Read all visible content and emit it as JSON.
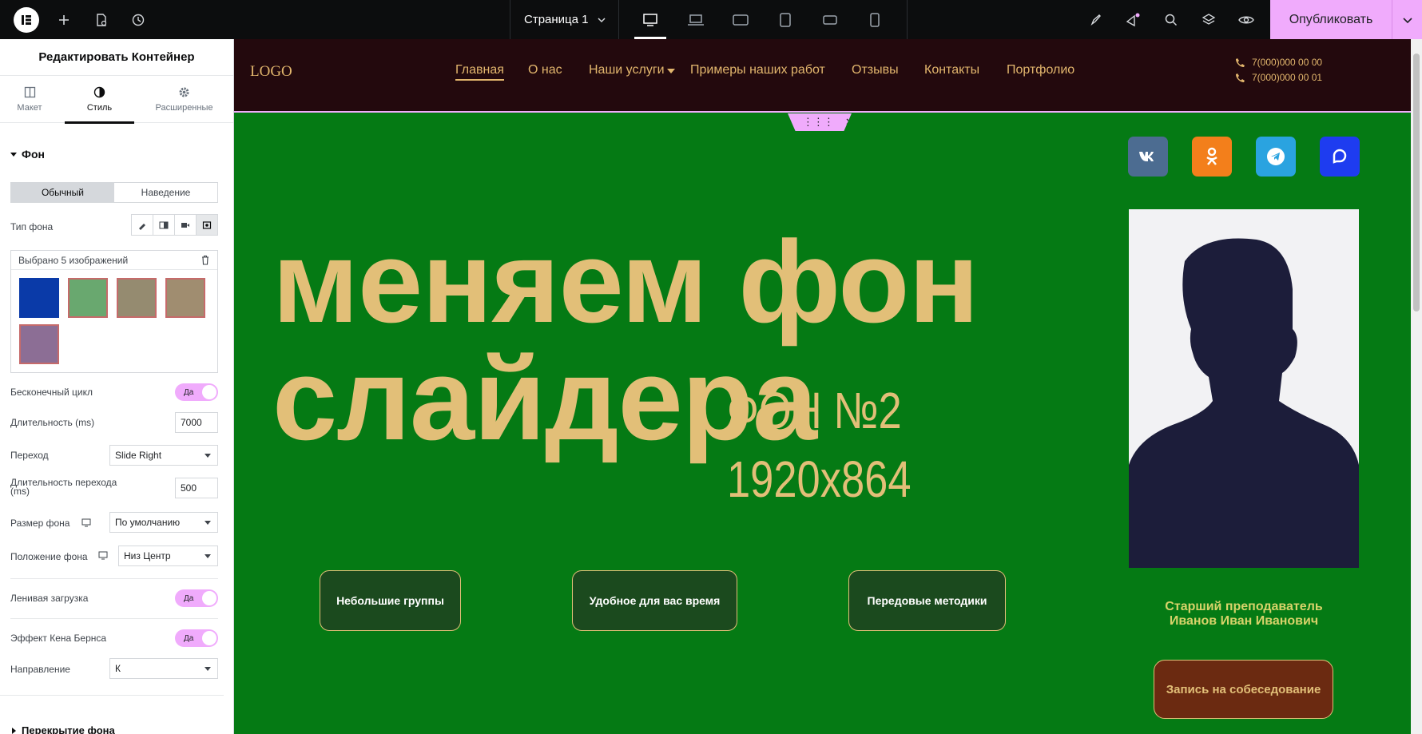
{
  "topbar": {
    "page_selector": "Страница 1",
    "publish_label": "Опубликовать",
    "colors": {
      "bg": "#0c0d0e",
      "publish": "#f0abfc"
    },
    "icons": [
      "elementor-logo-icon",
      "add-icon",
      "page-settings-icon",
      "history-icon",
      "desktop-icon",
      "laptop-icon",
      "tablet-landscape-icon",
      "tablet-portrait-icon",
      "mobile-landscape-icon",
      "mobile-portrait-icon",
      "rocket-icon",
      "notifications-icon",
      "search-icon",
      "structure-icon",
      "preview-icon",
      "chevron-down-icon"
    ]
  },
  "panel": {
    "title": "Редактировать Контейнер",
    "tabs": [
      {
        "label": "Макет",
        "icon": "layout-icon"
      },
      {
        "label": "Стиль",
        "icon": "style-icon"
      },
      {
        "label": "Расширенные",
        "icon": "gear-icon"
      }
    ],
    "section_title": "Фон",
    "state_tabs": [
      "Обычный",
      "Наведение"
    ],
    "bg_type_label": "Тип фона",
    "gallery_label": "Выбрано 5 изображений",
    "thumb_colors": [
      "#0a3aa8",
      "#69a86f",
      "#958b70",
      "#a08d70",
      "#8c6e95"
    ],
    "infinite_loop_label": "Бесконечный цикл",
    "infinite_loop_value": "Да",
    "duration_label": "Длительность (ms)",
    "duration_value": "7000",
    "transition_label": "Переход",
    "transition_value": "Slide Right",
    "transition_duration_label": "Длительность перехода (ms)",
    "transition_duration_value": "500",
    "bg_size_label": "Размер фона",
    "bg_size_value": "По умолчанию",
    "bg_position_label": "Положение фона",
    "bg_position_value": "Низ Центр",
    "lazy_load_label": "Ленивая загрузка",
    "lazy_load_value": "Да",
    "ken_burns_label": "Эффект Кена Бернса",
    "ken_burns_value": "Да",
    "direction_label": "Направление",
    "direction_value": "К",
    "overlay_section": "Перекрытие фона"
  },
  "site": {
    "logo": "LOGO",
    "nav": [
      "Главная",
      "О нас",
      "Наши услуги",
      "Примеры наших работ",
      "Отзывы",
      "Контакты",
      "Портфолио"
    ],
    "phones": [
      "7(000)000 00 00",
      "7(000)000 00 01"
    ],
    "headline_line1": "меняем фон",
    "headline_line2": "слайдера",
    "bg_caption_line1": "ФОН №2",
    "bg_caption_line2": "1920x864",
    "features": [
      "Небольшие группы",
      "Удобное для вас время",
      "Передовые методики"
    ],
    "teacher_line1": "Старший преподаватель",
    "teacher_line2": "Иванов Иван Иванович",
    "cta": "Запись на собеседование",
    "socials": [
      {
        "name": "vk-icon",
        "color": "#4c6c91"
      },
      {
        "name": "odnoklassniki-icon",
        "color": "#f37f1b"
      },
      {
        "name": "telegram-icon",
        "color": "#2aa3e0"
      },
      {
        "name": "max-messenger-icon",
        "color": "#1e3cf0"
      }
    ],
    "colors": {
      "header_bg": "#23090d",
      "canvas_bg": "#057a14",
      "accent": "#e2bf78"
    }
  }
}
